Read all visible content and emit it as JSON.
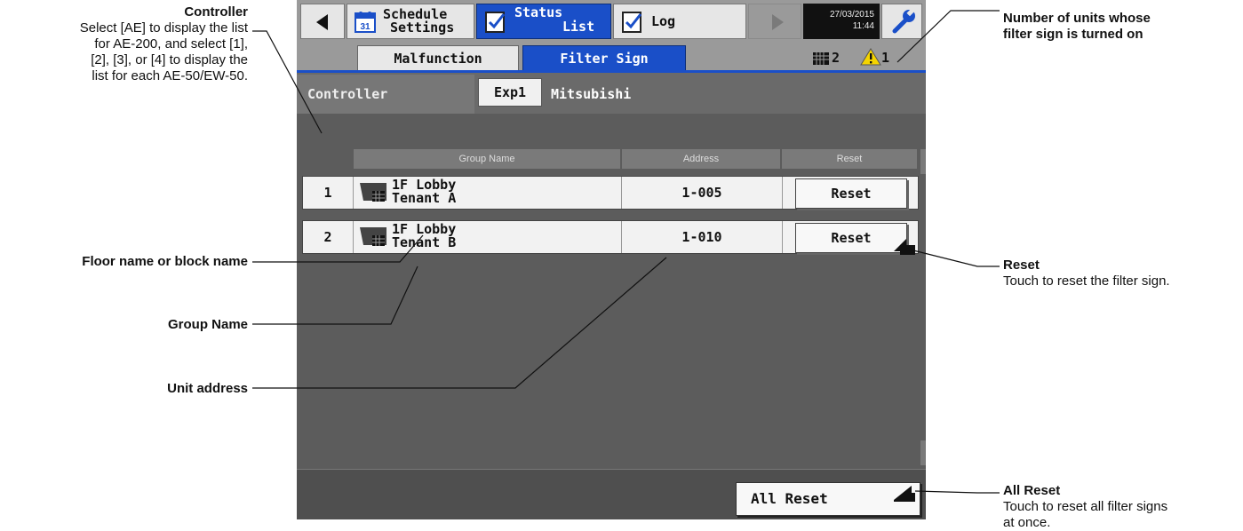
{
  "annotations": {
    "controller_title": "Controller",
    "controller_desc": [
      "Select [AE] to display the list",
      "for AE-200, and select [1],",
      "[2], [3], or [4] to display the",
      "list for each AE-50/EW-50."
    ],
    "floor_name": "Floor name or block name",
    "group_name": "Group Name",
    "unit_address": "Unit address",
    "units_count_title": [
      "Number of units whose",
      "filter sign is turned on"
    ],
    "reset_title": "Reset",
    "reset_desc": "Touch to reset the filter sign.",
    "all_reset_title": "All Reset",
    "all_reset_desc": [
      "Touch to reset all filter signs",
      "at once."
    ]
  },
  "topbar": {
    "schedule_line1": "Schedule",
    "schedule_line2": "Settings",
    "status_line1": "Status",
    "status_line2": "List",
    "log_label": "Log",
    "date": "27/03/2015",
    "time": "11:44"
  },
  "tabs": {
    "malfunction": "Malfunction",
    "filter_sign": "Filter Sign",
    "filter_count": "2",
    "warning_count": "1"
  },
  "controller": {
    "label": "Controller",
    "button": "Exp1",
    "name": "Mitsubishi"
  },
  "table": {
    "headers": {
      "group_name": "Group Name",
      "address": "Address",
      "reset": "Reset"
    },
    "rows": [
      {
        "num": "1",
        "floor": "1F Lobby",
        "group": "Tenant A",
        "address": "1-005",
        "reset": "Reset"
      },
      {
        "num": "2",
        "floor": "1F Lobby",
        "group": "Tenant B",
        "address": "1-010",
        "reset": "Reset"
      }
    ]
  },
  "bottom": {
    "all_reset": "All Reset"
  },
  "colors": {
    "accent_blue": "#1a4fc8",
    "panel_gray": "#5a5a5a",
    "warning_yellow": "#f5d400"
  },
  "icons": [
    "back-arrow-icon",
    "calendar-icon",
    "checklist-icon",
    "log-icon",
    "forward-arrow-icon",
    "wrench-icon",
    "filter-grid-icon",
    "warning-icon",
    "group-unit-icon",
    "scroll-up-icon",
    "scroll-down-icon",
    "pointer-arrow-icon"
  ]
}
